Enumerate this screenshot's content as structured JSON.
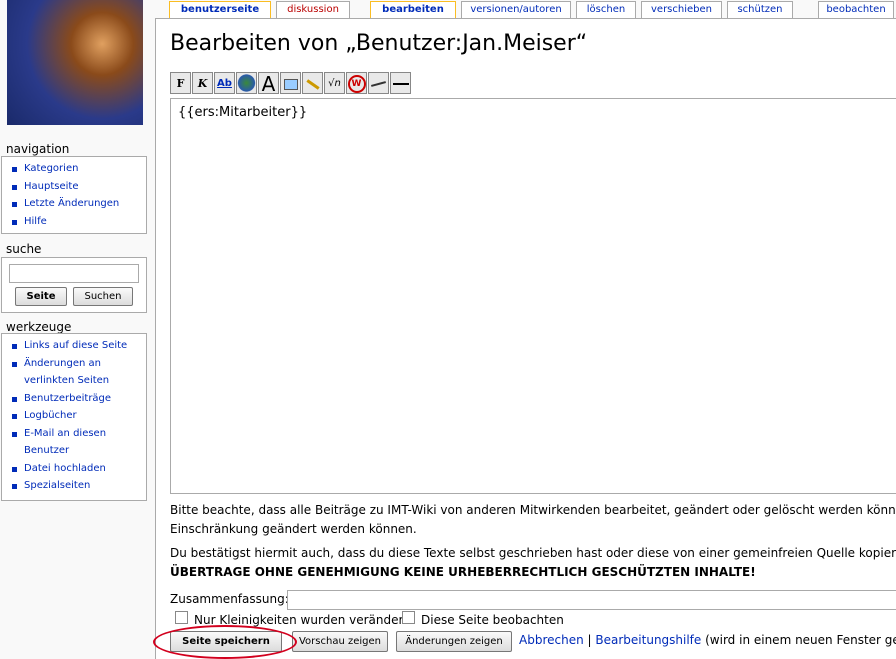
{
  "colors": {
    "link": "#002bb8",
    "new_link": "#ba0000",
    "tab_selected": "#fabd23",
    "highlight": "#d2001e"
  },
  "navigation": {
    "heading": "navigation",
    "items": [
      "Kategorien",
      "Hauptseite",
      "Letzte Änderungen",
      "Hilfe"
    ]
  },
  "search": {
    "heading": "suche",
    "go_label": "Seite",
    "search_label": "Suchen"
  },
  "tools": {
    "heading": "werkzeuge",
    "items": [
      "Links auf diese Seite",
      "Änderungen an",
      "verlinkten Seiten",
      "Benutzerbeiträge",
      "Logbücher",
      "E-Mail an diesen",
      "Benutzer",
      "Datei hochladen",
      "Spezialseiten"
    ]
  },
  "tabs": [
    "benutzerseite",
    "diskussion",
    "bearbeiten",
    "versionen/autoren",
    "löschen",
    "verschieben",
    "schützen",
    "beobachten"
  ],
  "page_title": "Bearbeiten von „Benutzer:Jan.Meiser“",
  "toolbar": [
    {
      "label": "F",
      "icon": "bold-icon"
    },
    {
      "label": "K",
      "icon": "italic-icon"
    },
    {
      "label": "Ab",
      "icon": "internal-link-icon"
    },
    {
      "label": "",
      "icon": "external-link-icon"
    },
    {
      "label": "A",
      "icon": "headline-icon"
    },
    {
      "label": "",
      "icon": "image-icon"
    },
    {
      "label": "",
      "icon": "media-icon"
    },
    {
      "label": "√n",
      "icon": "math-icon"
    },
    {
      "label": "W",
      "icon": "nowiki-icon"
    },
    {
      "label": "",
      "icon": "signature-icon"
    },
    {
      "label": "—",
      "icon": "horizontal-line-icon"
    }
  ],
  "editor": {
    "content": "{{ers:Mitarbeiter}}"
  },
  "notices": {
    "line1": "Bitte beachte, dass alle Beiträge zu IMT-Wiki von anderen Mitwirkenden bearbeitet, geändert oder gelöscht werden können. Re",
    "line2": "Einschränkung geändert werden können.",
    "line3": "Du bestätigst hiermit auch, dass du diese Texte selbst geschrieben hast oder diese von einer gemeinfreien Quelle kopiert hast",
    "line4": "ÜBERTRAGE OHNE GENEHMIGUNG KEINE URHEBERRECHTLICH GESCHÜTZTEN INHALTE!"
  },
  "summary": {
    "label": "Zusammenfassung:"
  },
  "checkboxes": {
    "minor": "Nur Kleinigkeiten wurden verändert",
    "watch": "Diese Seite beobachten"
  },
  "buttons": {
    "save": "Seite speichern",
    "preview": "Vorschau zeigen",
    "diff": "Änderungen zeigen"
  },
  "links": {
    "cancel": "Abbrechen",
    "separator": "|",
    "help": "Bearbeitungshilfe",
    "help_note": "(wird in einem neuen Fenster geöffn"
  }
}
